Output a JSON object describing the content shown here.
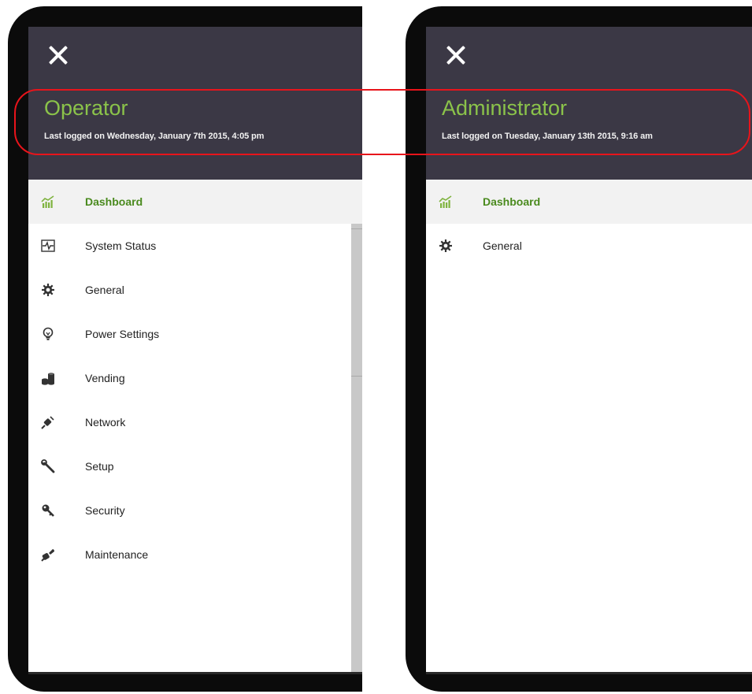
{
  "left_panel": {
    "role": "Operator",
    "last_logged": "Last logged on Wednesday, January 7th 2015, 4:05 pm",
    "nav": [
      {
        "label": "Dashboard",
        "icon": "chart-bars-icon",
        "active": true
      },
      {
        "label": "System Status",
        "icon": "pulse-monitor-icon"
      },
      {
        "label": "General",
        "icon": "gear-icon"
      },
      {
        "label": "Power Settings",
        "icon": "lightbulb-icon"
      },
      {
        "label": "Vending",
        "icon": "coins-icon"
      },
      {
        "label": "Network",
        "icon": "plug-icon"
      },
      {
        "label": "Setup",
        "icon": "wrench-icon"
      },
      {
        "label": "Security",
        "icon": "key-icon"
      },
      {
        "label": "Maintenance",
        "icon": "tools-icon"
      }
    ]
  },
  "right_panel": {
    "role": "Administrator",
    "last_logged": "Last logged on Tuesday, January 13th 2015, 9:16 am",
    "nav": [
      {
        "label": "Dashboard",
        "icon": "chart-bars-icon",
        "active": true
      },
      {
        "label": "General",
        "icon": "gear-icon"
      }
    ]
  },
  "colors": {
    "header_bg": "#3b3845",
    "role_text": "#8bc34a",
    "active_text": "#4a8a1e",
    "highlight": "#e8141b"
  }
}
